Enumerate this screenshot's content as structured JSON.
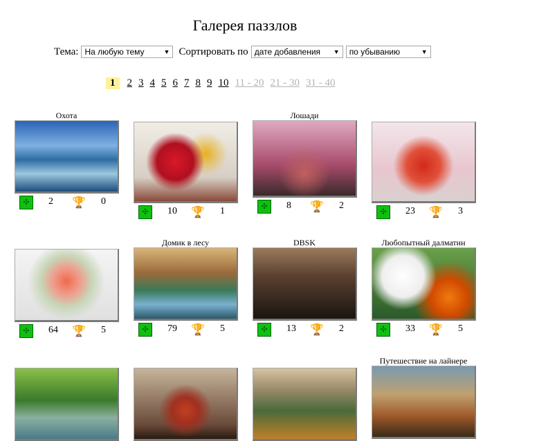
{
  "title": "Галерея паззлов",
  "filters": {
    "theme_label": "Тема:",
    "theme_value": "На любую тему",
    "sort_label": "Сортировать по",
    "sort_value": "дате добавления",
    "order_value": "по убыванию"
  },
  "pager": {
    "current": "1",
    "pages": [
      "2",
      "3",
      "4",
      "5",
      "6",
      "7",
      "8",
      "9",
      "10"
    ],
    "ranges": [
      "11 - 20",
      "21 - 30",
      "31 - 40"
    ]
  },
  "gallery": [
    {
      "caption": "Охота",
      "pieces": "2",
      "wins": "0",
      "image": "hunting-waves"
    },
    {
      "caption": "",
      "pieces": "10",
      "wins": "1",
      "image": "red-flowers-vase"
    },
    {
      "caption": "Лошади",
      "pieces": "8",
      "wins": "2",
      "image": "horses"
    },
    {
      "caption": "",
      "pieces": "23",
      "wins": "3",
      "image": "geisha"
    },
    {
      "caption": "",
      "pieces": "64",
      "wins": "5",
      "image": "bouquet"
    },
    {
      "caption": "Домик в лесу",
      "pieces": "79",
      "wins": "5",
      "image": "forest-house"
    },
    {
      "caption": "DBSK",
      "pieces": "13",
      "wins": "2",
      "image": "band-photo"
    },
    {
      "caption": "Любопытный далматин",
      "pieces": "33",
      "wins": "5",
      "image": "dalmatian"
    },
    {
      "caption": "",
      "image": "lake-house"
    },
    {
      "caption": "",
      "image": "fruit-still-life"
    },
    {
      "caption": "",
      "image": "mountain-forest"
    },
    {
      "caption": "Путешествие на лайнере",
      "image": "liner-travel"
    }
  ],
  "icons": {
    "puzzle": "puzzle-piece-icon",
    "trophy": "trophy-icon"
  }
}
